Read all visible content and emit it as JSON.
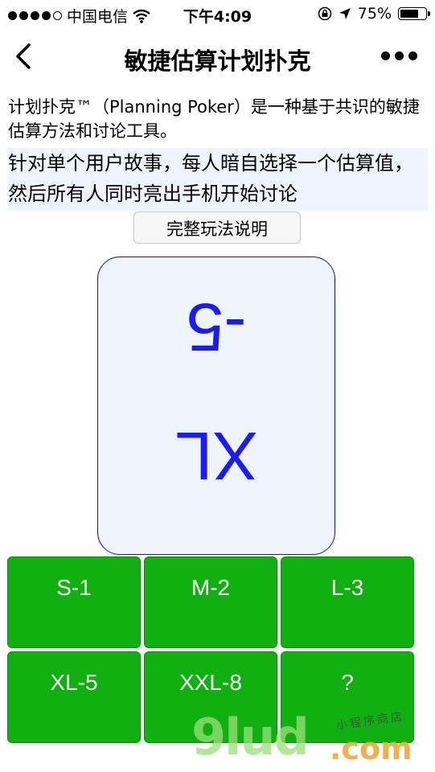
{
  "status_bar": {
    "carrier": "中国电信",
    "time": "下午4:09",
    "battery": "75%",
    "battery_level": 0.75,
    "signal_dots_filled": 4,
    "signal_dots_total": 5
  },
  "nav": {
    "title": "敏捷估算计划扑克",
    "back_icon": "chevron-left-icon",
    "more_icon": "more-dots-icon"
  },
  "intro": {
    "text": "计划扑克™（Planning Poker）是一种基于共识的敏捷估算方法和讨论工具。",
    "highlight": "针对单个用户故事，每人暗自选择一个估算值，然后所有人同时亮出手机开始讨论"
  },
  "rules_button": {
    "label": "完整玩法说明"
  },
  "card": {
    "value": "-5",
    "size": "XL",
    "text_color": "#1a1aff"
  },
  "options": [
    "S-1",
    "M-2",
    "L-3",
    "XL-5",
    "XXL-8",
    "?"
  ],
  "accent_green": "#11b011",
  "watermark": {
    "logo": "9lud",
    "suffix": ".com",
    "tagline": "小程序商店"
  }
}
